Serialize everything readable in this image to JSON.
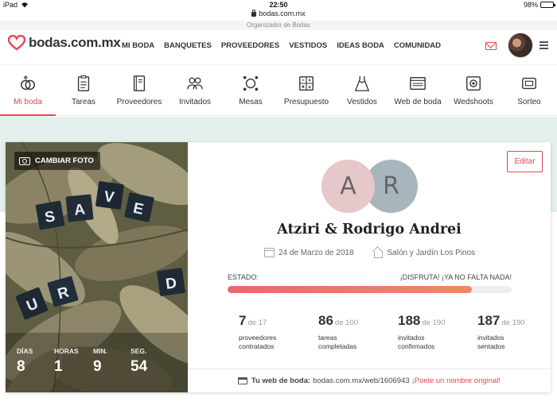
{
  "status_bar": {
    "device": "iPad",
    "time": "22:50",
    "battery": "98%"
  },
  "browser": {
    "url": "bodas.com.mx",
    "tab_title": "Organizador de Bodas"
  },
  "brand": {
    "name": "bodas.com.mx",
    "accent": "#e8474f"
  },
  "nav": {
    "items": [
      "MI BODA",
      "BANQUETES",
      "PROVEEDORES",
      "VESTIDOS",
      "IDEAS BODA",
      "COMUNIDAD"
    ]
  },
  "tools": {
    "items": [
      {
        "label": "Mi boda",
        "icon": "rings-icon",
        "active": true
      },
      {
        "label": "Tareas",
        "icon": "checklist-icon"
      },
      {
        "label": "Proveedores",
        "icon": "notebook-icon"
      },
      {
        "label": "Invitados",
        "icon": "guests-icon"
      },
      {
        "label": "Mesas",
        "icon": "table-icon"
      },
      {
        "label": "Presupuesto",
        "icon": "calculator-icon"
      },
      {
        "label": "Vestidos",
        "icon": "dress-icon"
      },
      {
        "label": "Web de boda",
        "icon": "website-icon"
      },
      {
        "label": "Wedshoots",
        "icon": "camera-icon"
      },
      {
        "label": "Sorteo",
        "icon": "gift-icon"
      }
    ]
  },
  "photo": {
    "change_label": "CAMBIAR FOTO",
    "tiles": [
      "S",
      "A",
      "V",
      "E",
      "U",
      "R",
      "D"
    ],
    "countdown": [
      {
        "key": "DÍAS",
        "value": "8"
      },
      {
        "key": "HORAS",
        "value": "1"
      },
      {
        "key": "MIN.",
        "value": "9"
      },
      {
        "key": "SEG.",
        "value": "54"
      }
    ]
  },
  "couple": {
    "edit_label": "Editar",
    "initial_a": "A",
    "initial_b": "R",
    "names": "Atziri & Rodrigo Andrei",
    "date": "24 de Marzo de 2018",
    "venue": "Salón y Jardín Los Pinos"
  },
  "status": {
    "label": "ESTADO:",
    "message": "¡DISFRUTA! ¡YA NO FALTA NADA!",
    "progress": 0.86
  },
  "stats": [
    {
      "num": "7",
      "of": "de 17",
      "line1": "proveedores",
      "line2": "contratados"
    },
    {
      "num": "86",
      "of": "de 100",
      "line1": "tareas",
      "line2": "completadas"
    },
    {
      "num": "188",
      "of": "de 190",
      "line1": "invitados",
      "line2": "confirmados"
    },
    {
      "num": "187",
      "of": "de 190",
      "line1": "invitados",
      "line2": "sentados"
    }
  ],
  "web": {
    "label": "Tu web de boda:",
    "url": "bodas.com.mx/web/1606943",
    "link": "¡Ponle un nombre original!"
  }
}
